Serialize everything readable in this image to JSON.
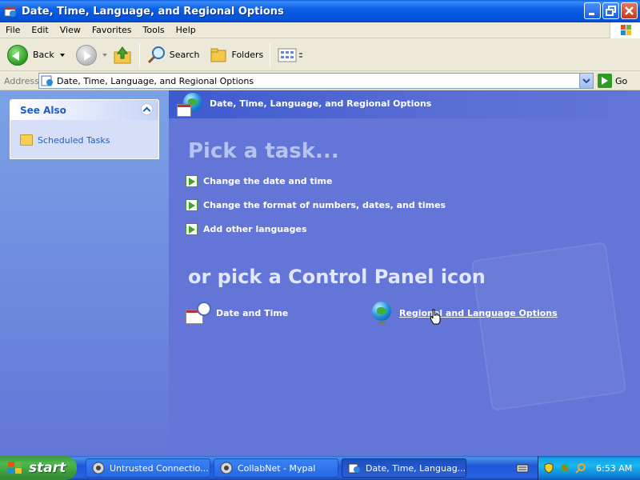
{
  "window": {
    "title": "Date, Time, Language, and Regional Options"
  },
  "menu": {
    "items": [
      "File",
      "Edit",
      "View",
      "Favorites",
      "Tools",
      "Help"
    ]
  },
  "toolbar": {
    "back_label": "Back",
    "search_label": "Search",
    "folders_label": "Folders"
  },
  "address": {
    "label": "Address",
    "value": "Date, Time, Language, and Regional Options",
    "go_label": "Go"
  },
  "sidebar": {
    "see_also_title": "See Also",
    "items": [
      {
        "label": "Scheduled Tasks",
        "icon": "scheduled-tasks-icon"
      }
    ]
  },
  "main": {
    "header_title": "Date, Time, Language, and Regional Options",
    "pick_task_heading": "Pick a task...",
    "tasks": [
      {
        "label": "Change the date and time"
      },
      {
        "label": "Change the format of numbers, dates, and times"
      },
      {
        "label": "Add other languages"
      }
    ],
    "pick_icon_heading": "or pick a Control Panel icon",
    "icons": [
      {
        "label": "Date and Time",
        "icon": "date-time-icon"
      },
      {
        "label": "Regional and Language Options",
        "icon": "globe-icon"
      }
    ]
  },
  "taskbar": {
    "start_label": "start",
    "buttons": [
      {
        "label": "Untrusted Connectio..."
      },
      {
        "label": "CollabNet - Mypal"
      },
      {
        "label": "Date, Time, Languag..."
      }
    ],
    "clock": "6:53 AM"
  },
  "colors": {
    "title_bar": "#0b5fe5",
    "main_background": "#6375d6",
    "sidebar_link": "#215dc6",
    "start_button": "#3c9a3c"
  }
}
